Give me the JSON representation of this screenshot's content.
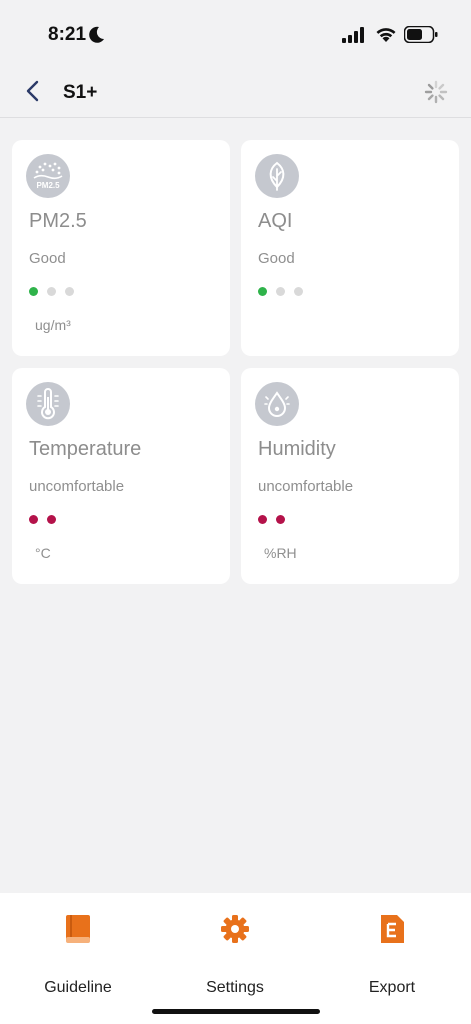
{
  "status_bar": {
    "time": "8:21"
  },
  "nav": {
    "title": "S1+"
  },
  "cards": [
    {
      "title": "PM2.5",
      "status": "Good",
      "unit": "ug/m³",
      "icon_text": "PM2.5",
      "icon": "pm25-icon",
      "level_dots": [
        "green",
        "gray",
        "gray"
      ]
    },
    {
      "title": "AQI",
      "status": "Good",
      "unit": "",
      "icon": "leaf-icon",
      "level_dots": [
        "green",
        "gray",
        "gray"
      ]
    },
    {
      "title": "Temperature",
      "status": "uncomfortable",
      "unit": "°C",
      "icon": "thermometer-icon",
      "level_dots": [
        "red",
        "red"
      ]
    },
    {
      "title": "Humidity",
      "status": "uncomfortable",
      "unit": "%RH",
      "icon": "droplet-icon",
      "level_dots": [
        "red",
        "red"
      ]
    }
  ],
  "tabs": [
    {
      "label": "Guideline",
      "icon": "book-icon"
    },
    {
      "label": "Settings",
      "icon": "gear-icon"
    },
    {
      "label": "Export",
      "icon": "export-file-icon"
    }
  ],
  "colors": {
    "accent": "#e8711b",
    "good": "#2fb34a",
    "bad": "#b4124a",
    "icon_bg": "#c5c8cf"
  }
}
